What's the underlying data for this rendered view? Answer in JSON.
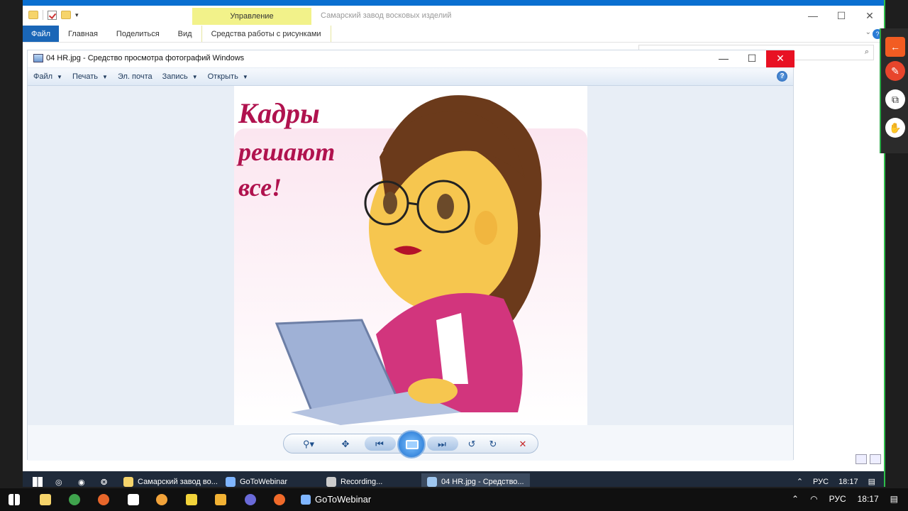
{
  "explorer": {
    "title": "Самарский завод восковых изделий",
    "manage_tab": "Управление",
    "ribbon": {
      "file": "Файл",
      "home": "Главная",
      "share": "Поделиться",
      "view": "Вид",
      "picture_tools": "Средства работы с рисунками"
    },
    "window_buttons": {
      "minimize": "—",
      "maximize": "☐",
      "close": "✕"
    }
  },
  "viewer": {
    "title": "04 HR.jpg - Средство просмотра фотографий Windows",
    "menu": [
      {
        "label": "Файл",
        "has_caret": true
      },
      {
        "label": "Печать",
        "has_caret": true
      },
      {
        "label": "Эл. почта",
        "has_caret": false
      },
      {
        "label": "Запись",
        "has_caret": true
      },
      {
        "label": "Открыть",
        "has_caret": true
      }
    ],
    "help_label": "?",
    "window_buttons": {
      "minimize": "—",
      "maximize": "☐",
      "close": "✕"
    },
    "image_caption": [
      "Кадры",
      "решают",
      "все!"
    ]
  },
  "remote_taskbar": {
    "items": [
      {
        "label": "Самарский завод во...",
        "icon": "folder-icon",
        "color": "#f6d46b"
      },
      {
        "label": "GoToWebinar",
        "icon": "gotowebinar-icon",
        "color": "#7fb5ff"
      },
      {
        "label": "Recording...",
        "icon": "recording-icon",
        "color": "#cccccc"
      },
      {
        "label": "04 HR.jpg - Средство...",
        "icon": "photo-viewer-icon",
        "color": "#9fc7f0"
      }
    ],
    "lang": "РУС",
    "time": "18:17"
  },
  "host_taskbar": {
    "app_label": "GoToWebinar",
    "lang": "РУС",
    "time": "18:17"
  },
  "colors": {
    "accent": "#0a6fd0",
    "close_red": "#e81123",
    "side_green": "#2fbf4a"
  }
}
